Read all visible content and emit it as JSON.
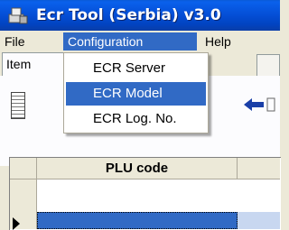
{
  "window": {
    "title": "Ecr Tool (Serbia) v3.0"
  },
  "menubar": {
    "file": "File",
    "configuration": "Configuration",
    "help": "Help"
  },
  "tabs": {
    "items_label": "Item"
  },
  "grid": {
    "column_header": "PLU code"
  },
  "configuration_menu": {
    "items": [
      "ECR Server",
      "ECR Model",
      "ECR Log. No."
    ],
    "highlighted_index": 1
  },
  "colors": {
    "title_bar": "#0550d8",
    "menu_highlight": "#316ac5",
    "background": "#ece9d8"
  }
}
